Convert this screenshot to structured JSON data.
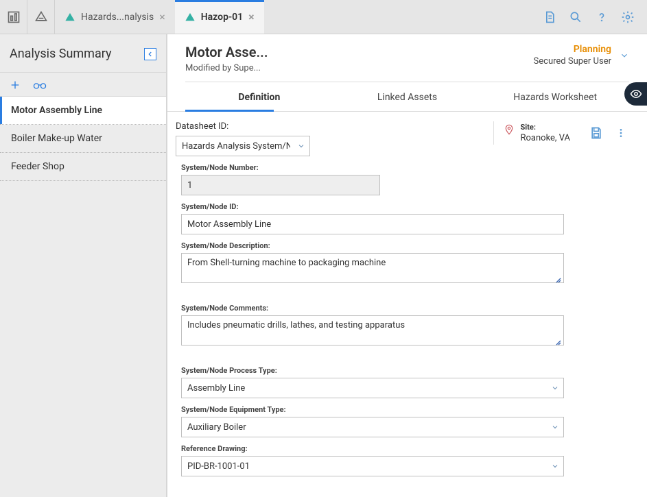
{
  "topbar": {
    "tabs": [
      {
        "label": "Hazards...nalysis"
      },
      {
        "label": "Hazop-01"
      }
    ]
  },
  "sidebar": {
    "title": "Analysis Summary",
    "items": [
      {
        "label": "Motor Assembly Line"
      },
      {
        "label": "Boiler Make-up Water"
      },
      {
        "label": "Feeder Shop"
      }
    ]
  },
  "header": {
    "title": "Motor Asse...",
    "modified_by": "Modified by Supe...",
    "status": "Planning",
    "user": "Secured Super User"
  },
  "subtabs": {
    "definition": "Definition",
    "linked_assets": "Linked Assets",
    "hazards_worksheet": "Hazards Worksheet"
  },
  "datasheet": {
    "label": "Datasheet ID:",
    "value": "Hazards Analysis System/Node",
    "site_label": "Site:",
    "site_value": "Roanoke, VA"
  },
  "fields": {
    "node_number": {
      "label": "System/Node Number:",
      "value": "1"
    },
    "node_id": {
      "label": "System/Node ID:",
      "value": "Motor Assembly Line"
    },
    "node_desc": {
      "label": "System/Node Description:",
      "value": "From Shell-turning machine to packaging machine"
    },
    "node_comments": {
      "label": "System/Node Comments:",
      "value": "Includes pneumatic drills, lathes, and testing apparatus"
    },
    "process_type": {
      "label": "System/Node Process Type:",
      "value": "Assembly Line"
    },
    "equipment_type": {
      "label": "System/Node Equipment Type:",
      "value": "Auxiliary Boiler"
    },
    "ref_drawing": {
      "label": "Reference Drawing:",
      "value": "PID-BR-1001-01"
    }
  }
}
